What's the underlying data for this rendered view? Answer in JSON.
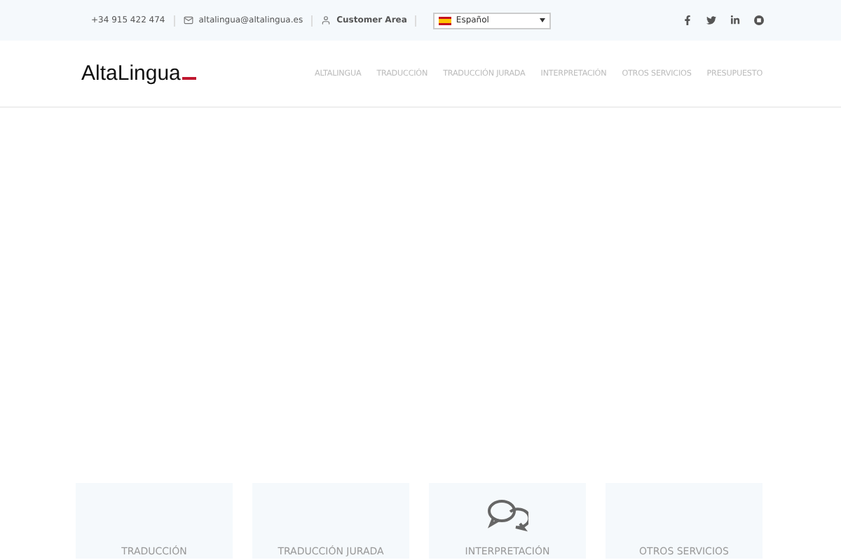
{
  "topbar": {
    "phone": "+34 915 422 474",
    "email": "altalingua@altalingua.es",
    "customer_area": "Customer Area",
    "language": {
      "value": "Español"
    }
  },
  "header": {
    "logo": "AltaLingua",
    "nav": [
      {
        "label": "ALTALINGUA",
        "selected": false
      },
      {
        "label": "TRADUCCIÓN",
        "selected": false
      },
      {
        "label": "TRADUCCIÓN JURADA",
        "selected": false
      },
      {
        "label": "INTERPRETACIÓN",
        "selected": false
      },
      {
        "label": "OTROS SERVICIOS",
        "selected": false
      },
      {
        "label": "PRESUPUESTO",
        "selected": false
      }
    ]
  },
  "services": [
    {
      "title": "TRADUCCIÓN",
      "icon_visible": false
    },
    {
      "title": "TRADUCCIÓN JURADA",
      "icon_visible": false
    },
    {
      "title": "INTERPRETACIÓN",
      "icon_visible": true
    },
    {
      "title": "OTROS SERVICIOS",
      "icon_visible": false
    }
  ]
}
